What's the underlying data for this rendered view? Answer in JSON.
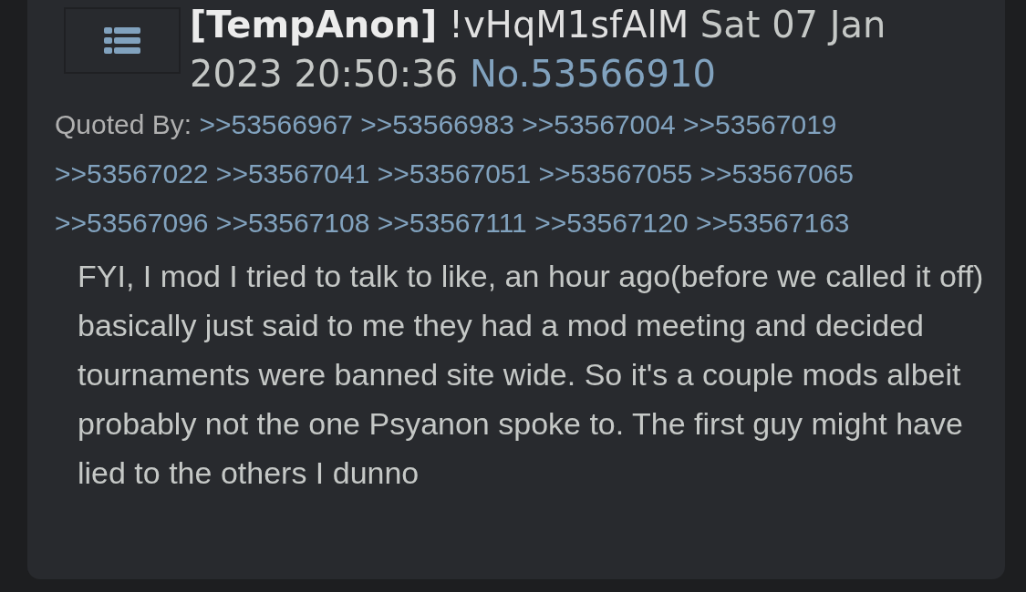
{
  "post": {
    "name": "[TempAnon]",
    "tripcode": "!vHqM1sfAlM",
    "datetime": [
      "Sat 07 Jan",
      "2023 20:50:36"
    ],
    "number": "No.53566910",
    "quoted_by_label": "Quoted By:",
    "quoted_by": [
      ">>53566967",
      ">>53566983",
      ">>53567004",
      ">>53567019",
      ">>53567022",
      ">>53567041",
      ">>53567051",
      ">>53567055",
      ">>53567065",
      ">>53567096",
      ">>53567108",
      ">>53567111",
      ">>53567120",
      ">>53567163"
    ],
    "message": "FYI, I mod I tried to talk to like, an hour ago(before we called it off) basically just said to me they had a mod meeting and decided tournaments were banned site wide. So it's a couple mods albeit probably not the one Psyanon spoke to. The first guy might have lied to the others I dunno"
  }
}
